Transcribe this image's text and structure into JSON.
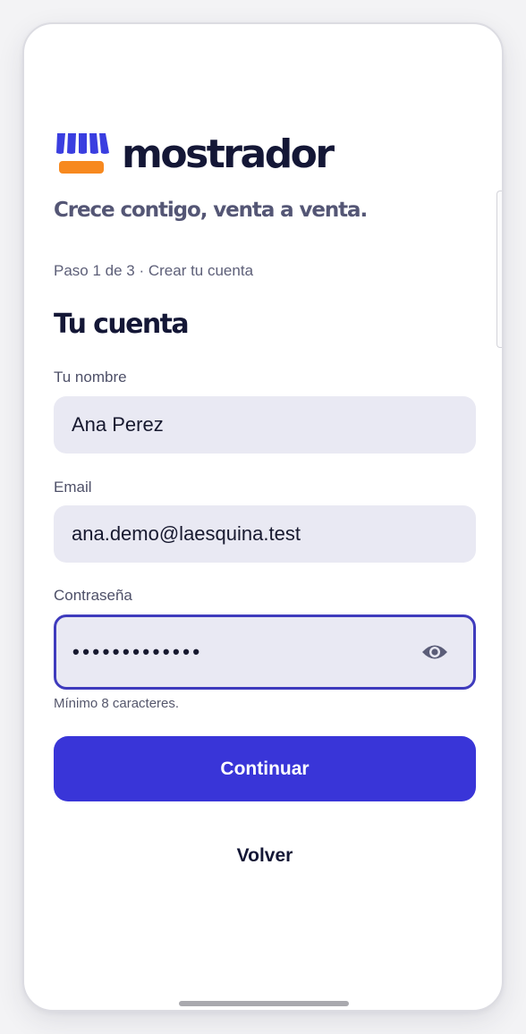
{
  "brand": {
    "name": "mostrador",
    "tagline": "Crece contigo, venta a venta.",
    "logo_icon": "storefront-awning-icon"
  },
  "step": "Paso 1 de 3 · Crear tu cuenta",
  "heading": "Tu cuenta",
  "form": {
    "name": {
      "label": "Tu nombre",
      "value": "Ana Perez"
    },
    "email": {
      "label": "Email",
      "value": "ana.demo@laesquina.test"
    },
    "password": {
      "label": "Contraseña",
      "value": "•••••••••••••",
      "helper": "Mínimo 8 caracteres.",
      "toggle_icon": "eye-icon"
    }
  },
  "actions": {
    "continue_label": "Continuar",
    "back_label": "Volver"
  },
  "colors": {
    "primary": "#3935d8",
    "brand_dark": "#141736",
    "awning_blue": "#3a3ee0",
    "awning_orange": "#f7891f",
    "field_bg": "#e9e9f3",
    "focus_border": "#3f3bbd"
  }
}
